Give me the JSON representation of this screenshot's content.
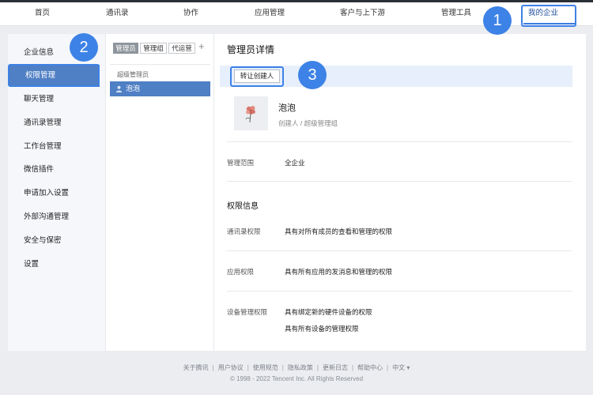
{
  "topnav": {
    "items": [
      "首页",
      "通讯录",
      "协作",
      "应用管理",
      "客户与上下游",
      "管理工具",
      "我的企业"
    ],
    "active_index": 6
  },
  "sidebar": {
    "items": [
      "企业信息",
      "权限管理",
      "聊天管理",
      "通讯录管理",
      "工作台管理",
      "微信插件",
      "申请加入设置",
      "外部沟通管理",
      "安全与保密",
      "设置"
    ],
    "active_index": 1
  },
  "middle": {
    "tabs": [
      "管理员",
      "管理组",
      "代运营"
    ],
    "active_tab": 0,
    "add_label": "+",
    "group_label": "超级管理员",
    "member_name": "泡泡"
  },
  "detail": {
    "title": "管理员详情",
    "transfer_button": "转让创建人",
    "name": "泡泡",
    "role": "创建人 / 超级管理组",
    "scope_label": "管理范围",
    "scope_value": "全企业",
    "perm_section": "权限信息",
    "contacts_label": "通讯录权限",
    "contacts_value": "具有对所有成员的查看和管理的权限",
    "apps_label": "应用权限",
    "apps_value": "具有所有应用的发消息和管理的权限",
    "devices_label": "设备管理权限",
    "devices_value_1": "具有绑定新的硬件设备的权限",
    "devices_value_2": "具有所有设备的管理权限"
  },
  "footer": {
    "links": [
      "关于腾讯",
      "用户协议",
      "使用规范",
      "隐私政策",
      "更新日志",
      "帮助中心",
      "中文 ▾"
    ],
    "copyright": "© 1998 - 2022 Tencent Inc. All Rights Reserved"
  },
  "callouts": [
    "1",
    "2",
    "3"
  ],
  "colors": {
    "accent": "#3d82e6",
    "selected": "#4f7fc4",
    "topbar_border": "#2b2f36"
  }
}
